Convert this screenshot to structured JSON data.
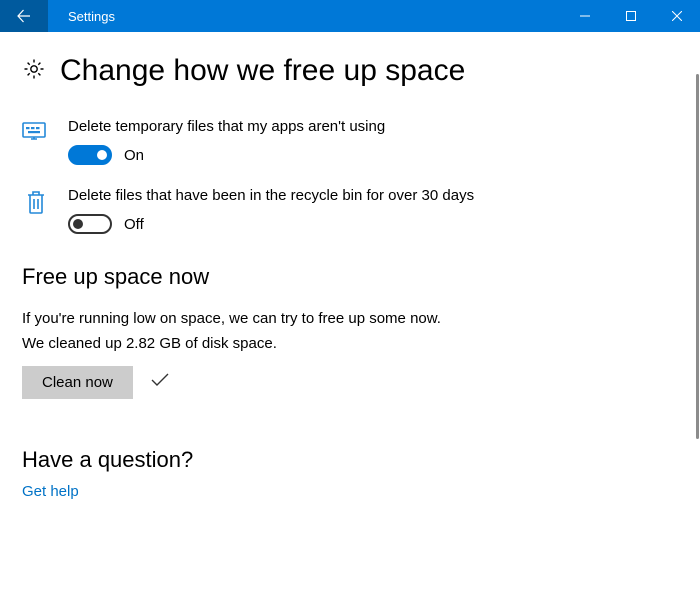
{
  "titlebar": {
    "app_name": "Settings"
  },
  "page": {
    "title": "Change how we free up space"
  },
  "settings": {
    "temp_files": {
      "label": "Delete temporary files that my apps aren't using",
      "status": "On"
    },
    "recycle_bin": {
      "label": "Delete files that have been in the recycle bin for over 30 days",
      "status": "Off"
    }
  },
  "free_up": {
    "heading": "Free up space now",
    "desc": "If you're running low on space, we can try to free up some now.",
    "result": "We cleaned up 2.82 GB of disk space.",
    "button": "Clean now"
  },
  "help": {
    "heading": "Have a question?",
    "link": "Get help"
  }
}
